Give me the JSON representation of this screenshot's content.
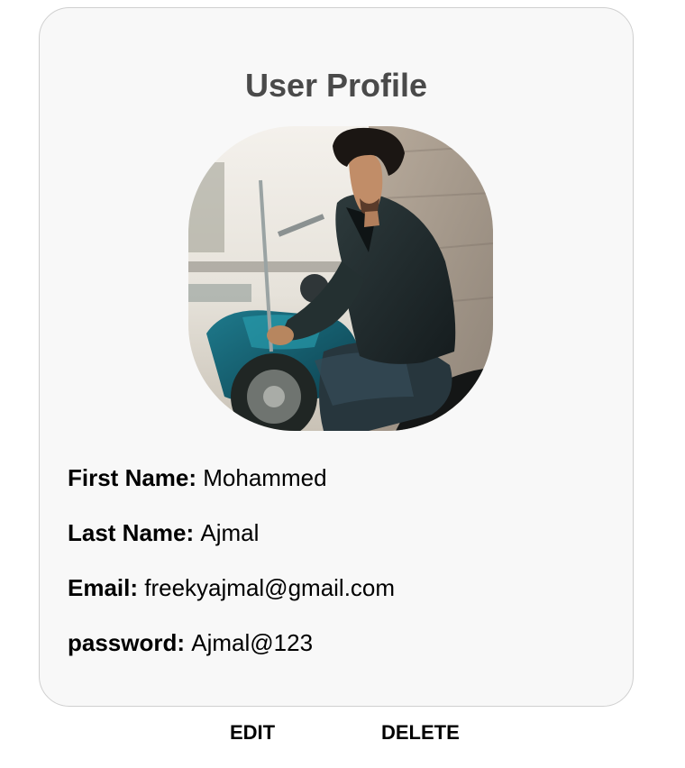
{
  "profile": {
    "title": "User Profile",
    "avatar_alt": "profile photo",
    "fields": [
      {
        "label": "First Name:",
        "value": "Mohammed"
      },
      {
        "label": "Last Name:",
        "value": "Ajmal"
      },
      {
        "label": "Email:",
        "value": "freekyajmal@gmail.com"
      },
      {
        "label": "password:",
        "value": "Ajmal@123"
      }
    ]
  },
  "actions": {
    "edit_label": "EDIT",
    "delete_label": "DELETE"
  },
  "colors": {
    "card_background": "#f8f8f8",
    "card_border": "#cfcfcf",
    "title_text": "#4a4a4a",
    "text": "#000000"
  }
}
